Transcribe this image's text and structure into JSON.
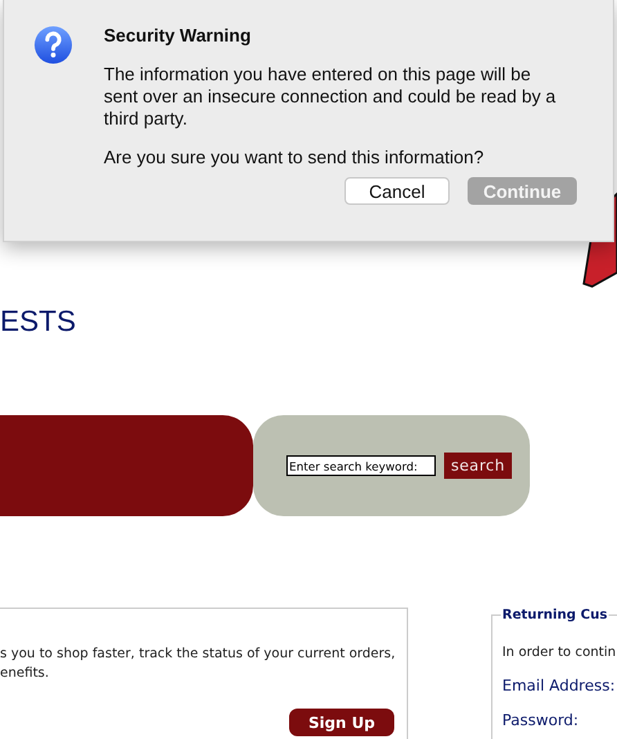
{
  "dialog": {
    "title": "Security Warning",
    "message": "The information you have entered on this page will be sent over an insecure connection and could be read by a third party.",
    "question": "Are you sure you want to send this information?",
    "buttons": [
      {
        "label": "Cancel",
        "kind": "secondary"
      },
      {
        "label": "Continue",
        "kind": "default"
      }
    ]
  },
  "heading": "ESTS",
  "search": {
    "placeholder": "Enter search keyword:",
    "button": "search"
  },
  "signup": {
    "lines": [
      "s you to shop faster, track the status of your current orders,",
      "enefits."
    ],
    "button": "Sign Up"
  },
  "returning": {
    "legend": "Returning Cus",
    "intro": "In order to contin",
    "fields": [
      "Email Address:",
      "Password:"
    ]
  }
}
